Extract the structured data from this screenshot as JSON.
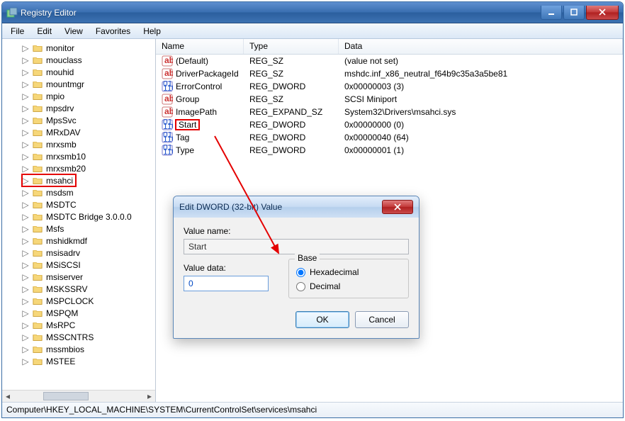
{
  "title": "Registry Editor",
  "menubar": {
    "file": "File",
    "edit": "Edit",
    "view": "View",
    "favorites": "Favorites",
    "help": "Help"
  },
  "tree": [
    "monitor",
    "mouclass",
    "mouhid",
    "mountmgr",
    "mpio",
    "mpsdrv",
    "MpsSvc",
    "MRxDAV",
    "mrxsmb",
    "mrxsmb10",
    "mrxsmb20",
    "msahci",
    "msdsm",
    "MSDTC",
    "MSDTC Bridge 3.0.0.0",
    "Msfs",
    "mshidkmdf",
    "msisadrv",
    "MSiSCSI",
    "msiserver",
    "MSKSSRV",
    "MSPCLOCK",
    "MSPQM",
    "MsRPC",
    "MSSCNTRS",
    "mssmbios",
    "MSTEE"
  ],
  "tree_highlight_index": 11,
  "columns": {
    "name": "Name",
    "type": "Type",
    "data": "Data"
  },
  "rows": [
    {
      "icon": "sz",
      "name": "(Default)",
      "type": "REG_SZ",
      "data": "(value not set)"
    },
    {
      "icon": "sz",
      "name": "DriverPackageId",
      "type": "REG_SZ",
      "data": "mshdc.inf_x86_neutral_f64b9c35a3a5be81"
    },
    {
      "icon": "dw",
      "name": "ErrorControl",
      "type": "REG_DWORD",
      "data": "0x00000003 (3)"
    },
    {
      "icon": "sz",
      "name": "Group",
      "type": "REG_SZ",
      "data": "SCSI Miniport"
    },
    {
      "icon": "sz",
      "name": "ImagePath",
      "type": "REG_EXPAND_SZ",
      "data": "System32\\Drivers\\msahci.sys"
    },
    {
      "icon": "dw",
      "name": "Start",
      "type": "REG_DWORD",
      "data": "0x00000000 (0)",
      "hi": true
    },
    {
      "icon": "dw",
      "name": "Tag",
      "type": "REG_DWORD",
      "data": "0x00000040 (64)"
    },
    {
      "icon": "dw",
      "name": "Type",
      "type": "REG_DWORD",
      "data": "0x00000001 (1)"
    }
  ],
  "dialog": {
    "title": "Edit DWORD (32-bit) Value",
    "value_name_label": "Value name:",
    "value_name": "Start",
    "value_data_label": "Value data:",
    "value_data": "0",
    "base_label": "Base",
    "hex_label": "Hexadecimal",
    "dec_label": "Decimal",
    "ok": "OK",
    "cancel": "Cancel"
  },
  "statusbar": "Computer\\HKEY_LOCAL_MACHINE\\SYSTEM\\CurrentControlSet\\services\\msahci"
}
